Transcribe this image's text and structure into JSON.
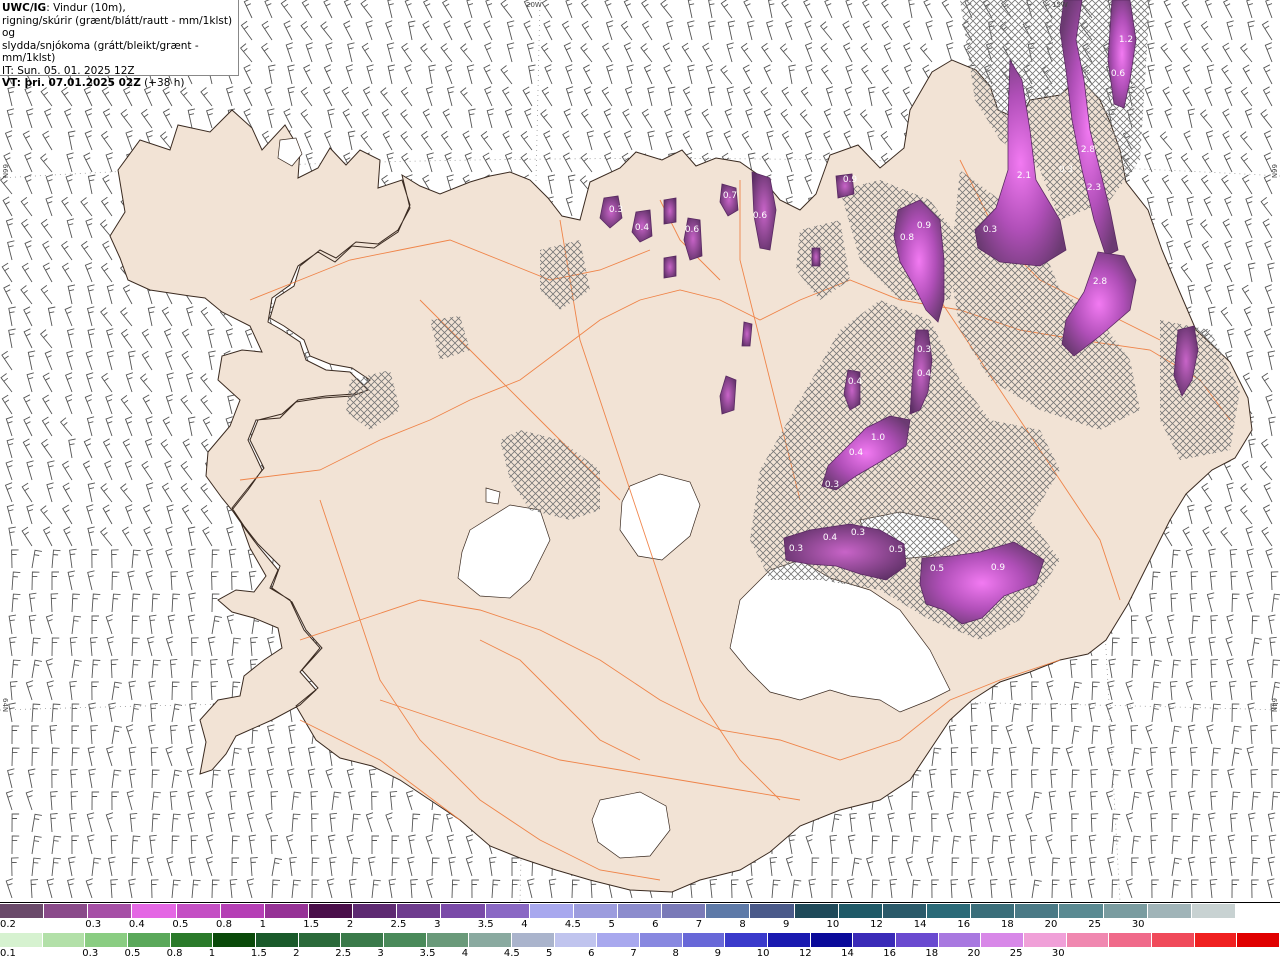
{
  "header": {
    "model": "UWC/IG",
    "line1_rest": ": Vindur (10m),",
    "line2": "rigning/skúrir (grænt/blátt/rautt - mm/1klst) og",
    "line3": "slydda/snjókoma (grátt/bleikt/grænt - mm/1klst)",
    "line4": "IT: Sun. 05. 01. 2025 12Z",
    "vt_label": "VT: þri. 07.01.2025 02Z",
    "vt_rest": " (+38 h)"
  },
  "edge_labels": {
    "top_20w": "20W",
    "top_15w": "15W",
    "left_66n": "66N",
    "left_64n": "64N",
    "right_66n": "66N",
    "right_64n": "64N"
  },
  "map": {
    "land_color": "#f2e3d5",
    "coast_color": "#3a2a20",
    "road_color": "#ef7a3a",
    "glacier_color": "#ffffff",
    "hatch_color": "#6e6e6e",
    "precip_values": [
      {
        "v": "1.2"
      },
      {
        "v": "0.6"
      },
      {
        "v": "2.8"
      },
      {
        "v": "2.3"
      },
      {
        "v": "2.1"
      },
      {
        "v": "0.3"
      },
      {
        "v": "2.8"
      },
      {
        "v": "0.3"
      },
      {
        "v": "0.9"
      },
      {
        "v": "0.8"
      },
      {
        "v": "0.3"
      },
      {
        "v": "0.4"
      },
      {
        "v": "0.4"
      },
      {
        "v": "1.0"
      },
      {
        "v": "0.4"
      },
      {
        "v": "0.3"
      },
      {
        "v": "0.3"
      },
      {
        "v": "0.4"
      },
      {
        "v": "0.3"
      },
      {
        "v": "0.5"
      },
      {
        "v": "0.5"
      },
      {
        "v": "0.9"
      },
      {
        "v": "0.3"
      },
      {
        "v": "0.4"
      },
      {
        "v": "0.6"
      },
      {
        "v": "0.7"
      },
      {
        "v": "0.6"
      },
      {
        "v": "0.9"
      }
    ]
  },
  "legend": {
    "snow_colors": [
      "#6b4a6b",
      "#8a4a8a",
      "#a64fa6",
      "#e467e4",
      "#c44fc4",
      "#b53fb5",
      "#963296",
      "#4a0f4a",
      "#5e2a72",
      "#6e3c8e",
      "#7a4aa8",
      "#8a68c4",
      "#a8a8ee",
      "#9c9cde",
      "#8c8ccd",
      "#7a7ab8",
      "#5e7aa8",
      "#4a5a8a",
      "#1f4a5a",
      "#1f5a68",
      "#2a5a6a",
      "#2a6a78",
      "#3a6e7a",
      "#4a7a86",
      "#5a8a92",
      "#7a9ca0",
      "#a0b4b8",
      "#c8d2d2",
      "#ffffff"
    ],
    "snow_labels": [
      "0.2",
      "0.3",
      "0.4",
      "0.5",
      "0.8",
      "1",
      "1.5",
      "2",
      "2.5",
      "3",
      "3.5",
      "4",
      "4.5",
      "5",
      "6",
      "7",
      "8",
      "9",
      "10",
      "12",
      "14",
      "16",
      "18",
      "20",
      "25",
      "30"
    ],
    "rain_colors": [
      "#d6f2d0",
      "#b2e0a8",
      "#8acd82",
      "#5aa85a",
      "#2a7a2a",
      "#0a4a0a",
      "#1a5a2a",
      "#2a6a3a",
      "#3a7a4a",
      "#4a8a5a",
      "#6a9a7a",
      "#8aaaa0",
      "#aab4cc",
      "#c0c4ee",
      "#a8a8ee",
      "#8888e0",
      "#6868d8",
      "#3a3acb",
      "#1a1ab0",
      "#0a0a9a",
      "#3a2ab8",
      "#6a4ad0",
      "#a878e0",
      "#d888e8",
      "#f0a0d8",
      "#f088b0",
      "#f06a8a",
      "#f04a5a",
      "#f02020",
      "#e00000"
    ],
    "rain_labels": [
      "0.1",
      "0.3",
      "0.5",
      "0.8",
      "1",
      "1.5",
      "2",
      "2.5",
      "3",
      "3.5",
      "4",
      "4.5",
      "5",
      "6",
      "7",
      "8",
      "9",
      "10",
      "12",
      "14",
      "16",
      "18",
      "20",
      "25",
      "30"
    ]
  }
}
